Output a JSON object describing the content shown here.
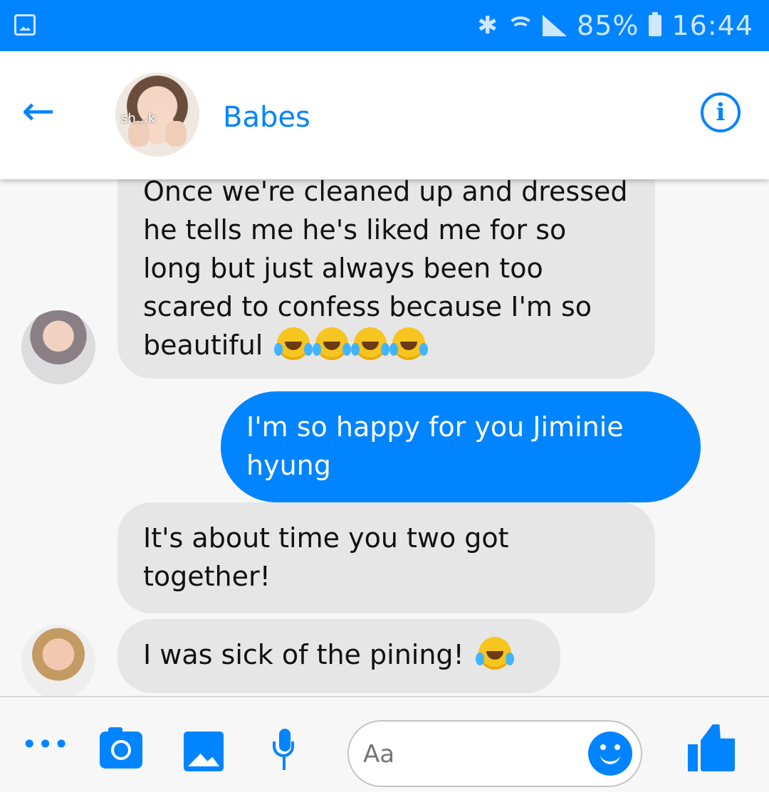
{
  "statusbar": {
    "battery_percent": "85%",
    "time": "16:44",
    "icons": [
      "gallery-icon",
      "bluetooth-icon",
      "wifi-icon",
      "signal-icon",
      "battery-icon"
    ]
  },
  "header": {
    "contact_name": "Babes",
    "avatar_tag_text": "sh...k",
    "back_icon": "back-arrow-icon",
    "info_icon": "info-icon"
  },
  "messages": [
    {
      "side": "incoming",
      "text": "Once we're cleaned up and dressed he tells me he's liked me for so long but just always been too scared to confess because I'm so beautiful"
    },
    {
      "side": "outgoing",
      "text": "I'm so happy for you Jiminie hyung"
    },
    {
      "side": "incoming",
      "text": "It's about time you two got together!"
    },
    {
      "side": "incoming",
      "text": "I was sick of the pining!"
    }
  ],
  "composer": {
    "placeholder": "Aa",
    "icons": [
      "more-icon",
      "camera-icon",
      "gallery-icon",
      "microphone-icon",
      "emoji-icon",
      "like-icon"
    ]
  },
  "colors": {
    "accent": "#0084ff",
    "incoming_bubble": "#e6e6e6",
    "outgoing_bubble": "#0084ff"
  }
}
